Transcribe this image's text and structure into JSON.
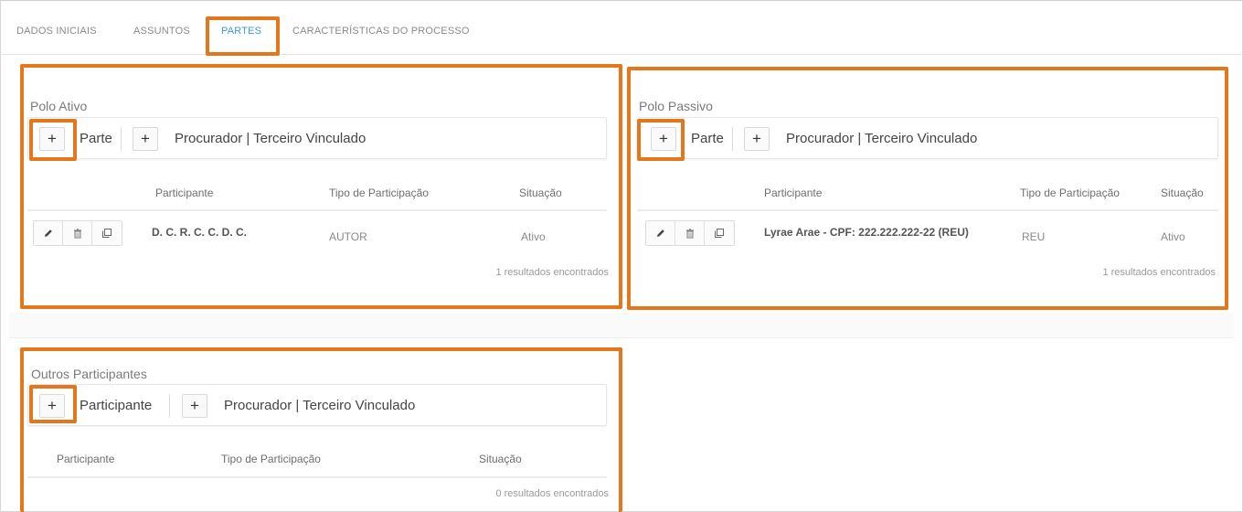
{
  "tabs": [
    {
      "label": "DADOS INICIAIS"
    },
    {
      "label": "ASSUNTOS"
    },
    {
      "label": "PARTES"
    },
    {
      "label": "CARACTERÍSTICAS DO PROCESSO"
    }
  ],
  "polo_ativo": {
    "title": "Polo Ativo",
    "add_parte_label": "Parte",
    "add_procurador_label": "Procurador | Terceiro Vinculado",
    "plus_symbol": "+",
    "headers": [
      "Participante",
      "Tipo de Participação",
      "Situação"
    ],
    "rows": [
      {
        "participante": "D. C. R. C. C. D. C.",
        "tipo": "AUTOR",
        "situacao": "Ativo"
      }
    ],
    "results": "1 resultados encontrados"
  },
  "polo_passivo": {
    "title": "Polo Passivo",
    "add_parte_label": "Parte",
    "add_procurador_label": "Procurador | Terceiro Vinculado",
    "plus_symbol": "+",
    "headers": [
      "Participante",
      "Tipo de Participação",
      "Situação"
    ],
    "rows": [
      {
        "participante": "Lyrae Arae - CPF: 222.222.222-22 (REU)",
        "tipo": "REU",
        "situacao": "Ativo"
      }
    ],
    "results": "1 resultados encontrados"
  },
  "outros": {
    "title": "Outros Participantes",
    "add_participante_label": "Participante",
    "add_procurador_label": "Procurador | Terceiro Vinculado",
    "plus_symbol": "+",
    "headers": [
      "Participante",
      "Tipo de Participação",
      "Situação"
    ],
    "results": "0 resultados encontrados"
  },
  "colors": {
    "annotation": "#e4761b",
    "active_tab": "#3a9bd3"
  },
  "icons": [
    "pencil-icon",
    "trash-icon",
    "copy-icon"
  ]
}
